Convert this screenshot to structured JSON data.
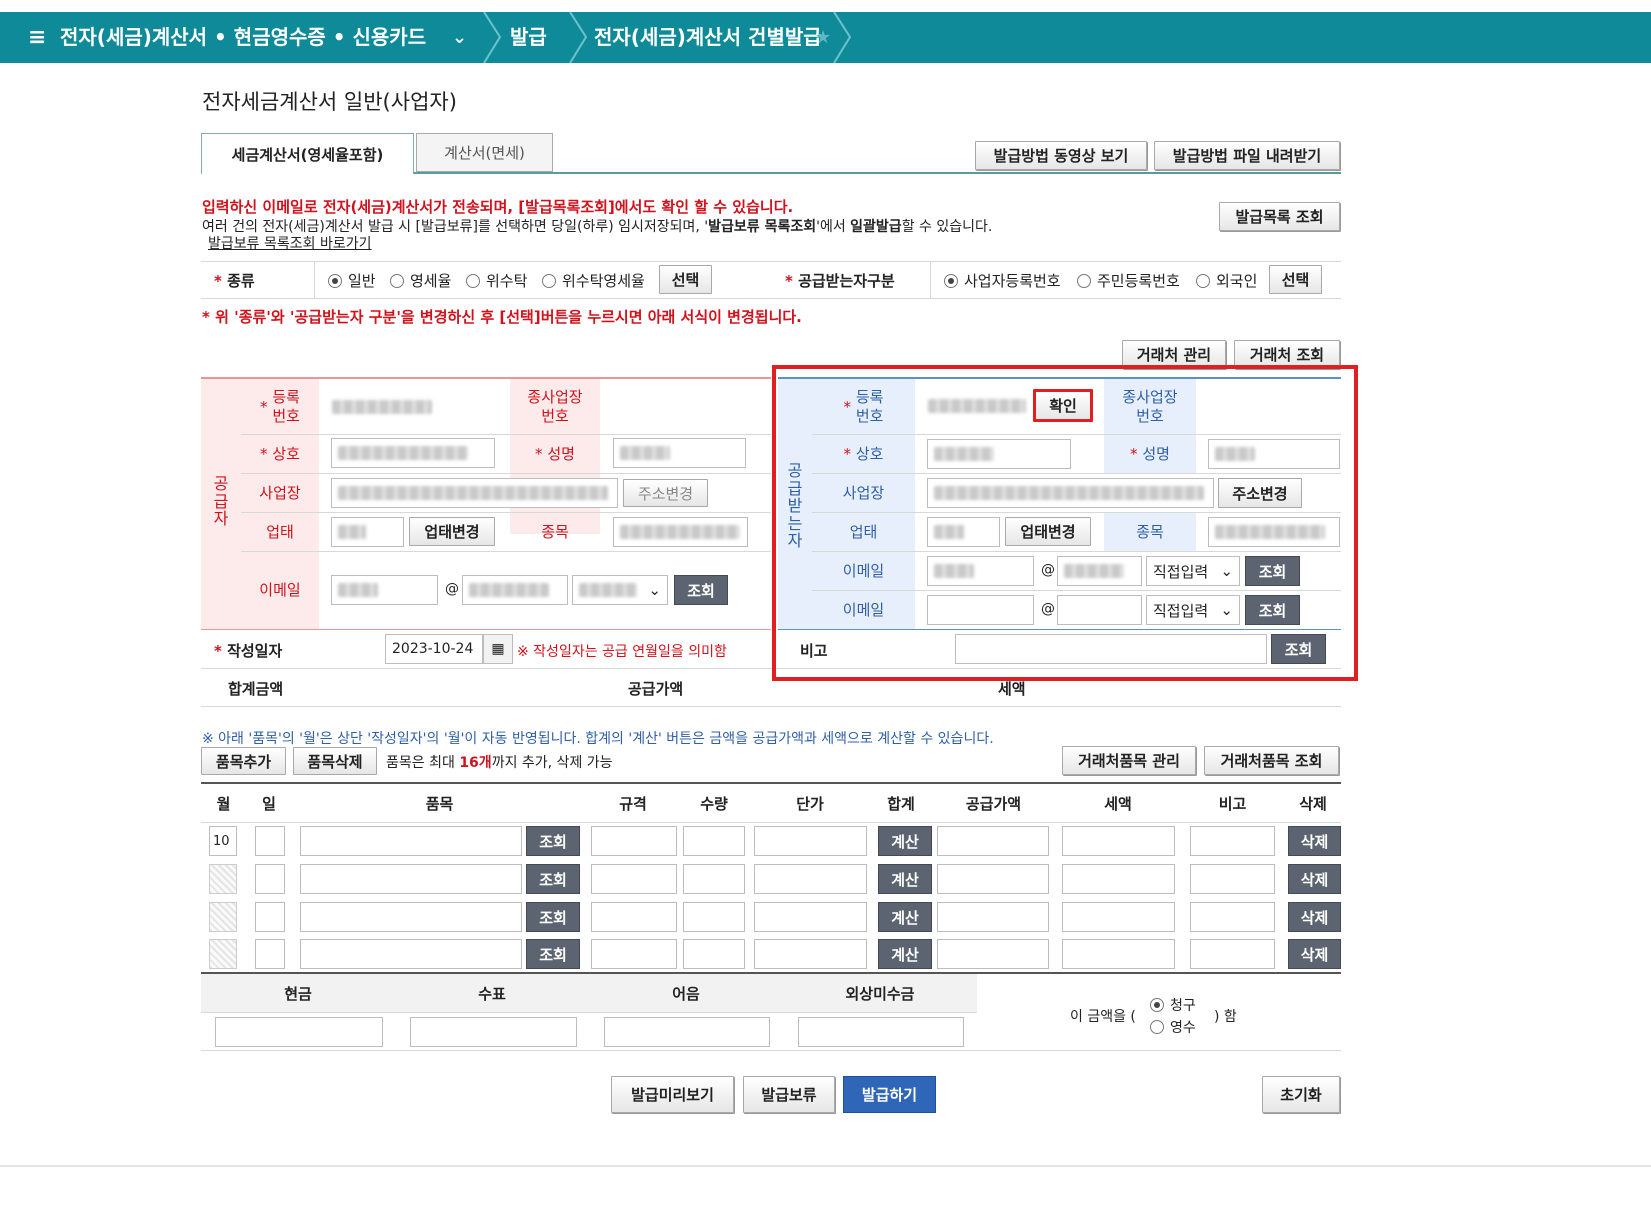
{
  "header": {
    "menu_title": "전자(세금)계산서 • 현금영수증 • 신용카드",
    "crumb1": "발급",
    "crumb2": "전자(세금)계산서 건별발급"
  },
  "page_title": "전자세금계산서 일반(사업자)",
  "tabs": [
    "세금계산서(영세율포함)",
    "계산서(면세)"
  ],
  "top_buttons": {
    "video": "발급방법 동영상 보기",
    "file": "발급방법 파일 내려받기",
    "list": "발급목록 조회"
  },
  "notice": {
    "red_line": "입력하신 이메일로 전자(세금)계산서가 전송되며, [발급목록조회]에서도 확인 할 수 있습니다.",
    "line2_a": "여러 건의 전자(세금)계산서 발급 시 [발급보류]를 선택하면 당일(하루) 임시저장되며, '",
    "line2_b": "발급보류 목록조회",
    "line2_c": "'에서 ",
    "line2_d": "일괄발급",
    "line2_e": "할 수 있습니다.",
    "link": "발급보류 목록조회 바로가기"
  },
  "kind": {
    "label": "종류",
    "options": [
      "일반",
      "영세율",
      "위수탁",
      "위수탁영세율"
    ],
    "selected": "일반",
    "btn": "선택"
  },
  "receiver_type": {
    "label": "공급받는자구분",
    "options": [
      "사업자등록번호",
      "주민등록번호",
      "외국인"
    ],
    "selected": "사업자등록번호",
    "btn": "선택"
  },
  "change_notice": "위 '종류'와 '공급받는자 구분'을 변경하신 후 [선택]버튼을 누르시면 아래 서식이 변경됩니다.",
  "partner_buttons": {
    "manage": "거래처 관리",
    "search": "거래처 조회"
  },
  "supplier": {
    "side": "공급자",
    "reg_no": "등록\n번호",
    "sub_biz": "종사업장\n번호",
    "name": "상호",
    "rep": "성명",
    "addr": "사업장",
    "addr_btn": "주소변경",
    "biz_type": "업태",
    "biz_btn": "업태변경",
    "item": "종목",
    "email": "이메일",
    "at": "@",
    "search_btn": "조회"
  },
  "receiver": {
    "side": "공급받는자",
    "reg_no": "등록\n번호",
    "confirm_btn": "확인",
    "sub_biz": "종사업장\n번호",
    "name": "상호",
    "rep": "성명",
    "addr": "사업장",
    "addr_btn": "주소변경",
    "biz_type": "업태",
    "biz_btn": "업태변경",
    "item": "종목",
    "email": "이메일",
    "at": "@",
    "direct": "직접입력",
    "search_btn": "조회"
  },
  "write_date": {
    "label": "작성일자",
    "value": "2023-10-24",
    "note": "※ 작성일자는 공급 연월일을 의미함"
  },
  "remark": {
    "label": "비고",
    "btn": "조회"
  },
  "totals": {
    "total": "합계금액",
    "supply": "공급가액",
    "tax": "세액"
  },
  "items_notice": "※ 아래 '품목'의 '월'은 상단 '작성일자'의 '월'이 자동 반영됩니다. 합계의 '계산' 버튼은 금액을 공급가액과 세액으로 계산할 수 있습니다.",
  "items_toolbar": {
    "add": "품목추가",
    "delete": "품목삭제",
    "limit_a": "품목은 최대 ",
    "limit_b": "16개",
    "limit_c": "까지 추가, 삭제 가능",
    "manage": "거래처품목 관리",
    "search": "거래처품목 조회"
  },
  "items_headers": [
    "월",
    "일",
    "품목",
    "규격",
    "수량",
    "단가",
    "합계",
    "공급가액",
    "세액",
    "비고",
    "삭제"
  ],
  "item_rows": [
    {
      "month": "10",
      "search": "조회",
      "calc": "계산",
      "del": "삭제"
    },
    {
      "month": "",
      "search": "조회",
      "calc": "계산",
      "del": "삭제"
    },
    {
      "month": "",
      "search": "조회",
      "calc": "계산",
      "del": "삭제"
    },
    {
      "month": "",
      "search": "조회",
      "calc": "계산",
      "del": "삭제"
    }
  ],
  "payment": {
    "headers": [
      "현금",
      "수표",
      "어음",
      "외상미수금"
    ],
    "prefix": "이 금액을 (",
    "opt1": "청구",
    "opt2": "영수",
    "suffix": ") 함"
  },
  "bottom_buttons": {
    "preview": "발급미리보기",
    "hold": "발급보류",
    "issue": "발급하기",
    "reset": "초기화"
  },
  "colors": {
    "teal": "#0e8a99",
    "red_box": "#e02020",
    "issue_blue": "#2f66b8"
  }
}
